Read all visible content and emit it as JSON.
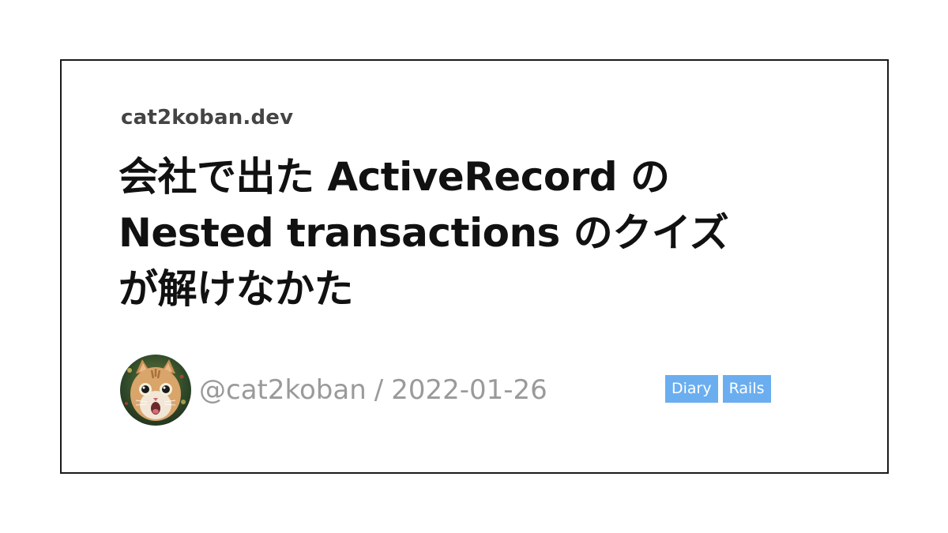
{
  "site": {
    "name": "cat2koban.dev"
  },
  "post": {
    "title_lines": [
      "会社で出た ActiveRecord の",
      "Nested transactions のクイズ",
      "が解けなかた"
    ],
    "author": "@cat2koban",
    "separator": "/",
    "date": "2022-01-26"
  },
  "tags": [
    "Diary",
    "Rails"
  ],
  "avatar": {
    "icon": "cat-avatar-icon",
    "face_color": "#d9a56a",
    "background_color": "#2f4a2a"
  },
  "colors": {
    "tag_background": "#6aaef0",
    "byline": "#9a9a9a",
    "title": "#111111",
    "site_name": "#444444",
    "border": "#1a1a1a"
  }
}
